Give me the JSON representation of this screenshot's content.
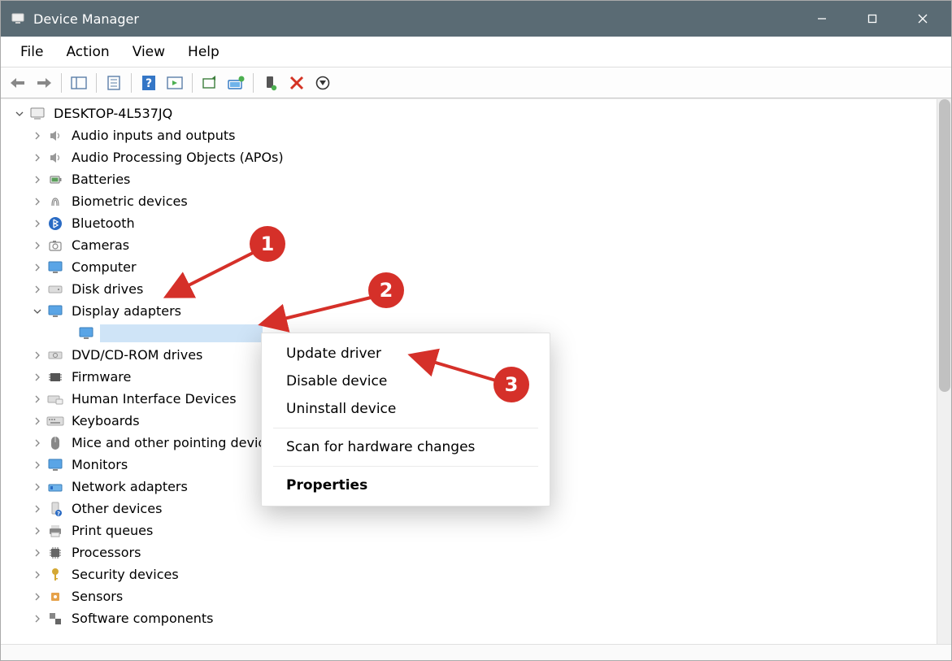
{
  "window": {
    "title": "Device Manager"
  },
  "menu": {
    "file": "File",
    "action": "Action",
    "view": "View",
    "help": "Help"
  },
  "tree": {
    "root": "DESKTOP-4L537JQ",
    "items": [
      "Audio inputs and outputs",
      "Audio Processing Objects (APOs)",
      "Batteries",
      "Biometric devices",
      "Bluetooth",
      "Cameras",
      "Computer",
      "Disk drives",
      "Display adapters",
      "DVD/CD-ROM drives",
      "Firmware",
      "Human Interface Devices",
      "Keyboards",
      "Mice and other pointing devices",
      "Monitors",
      "Network adapters",
      "Other devices",
      "Print queues",
      "Processors",
      "Security devices",
      "Sensors",
      "Software components"
    ],
    "selected_device": " "
  },
  "context_menu": {
    "update": "Update driver",
    "disable": "Disable device",
    "uninstall": "Uninstall device",
    "scan": "Scan for hardware changes",
    "properties": "Properties"
  },
  "annotations": {
    "b1": "1",
    "b2": "2",
    "b3": "3"
  }
}
